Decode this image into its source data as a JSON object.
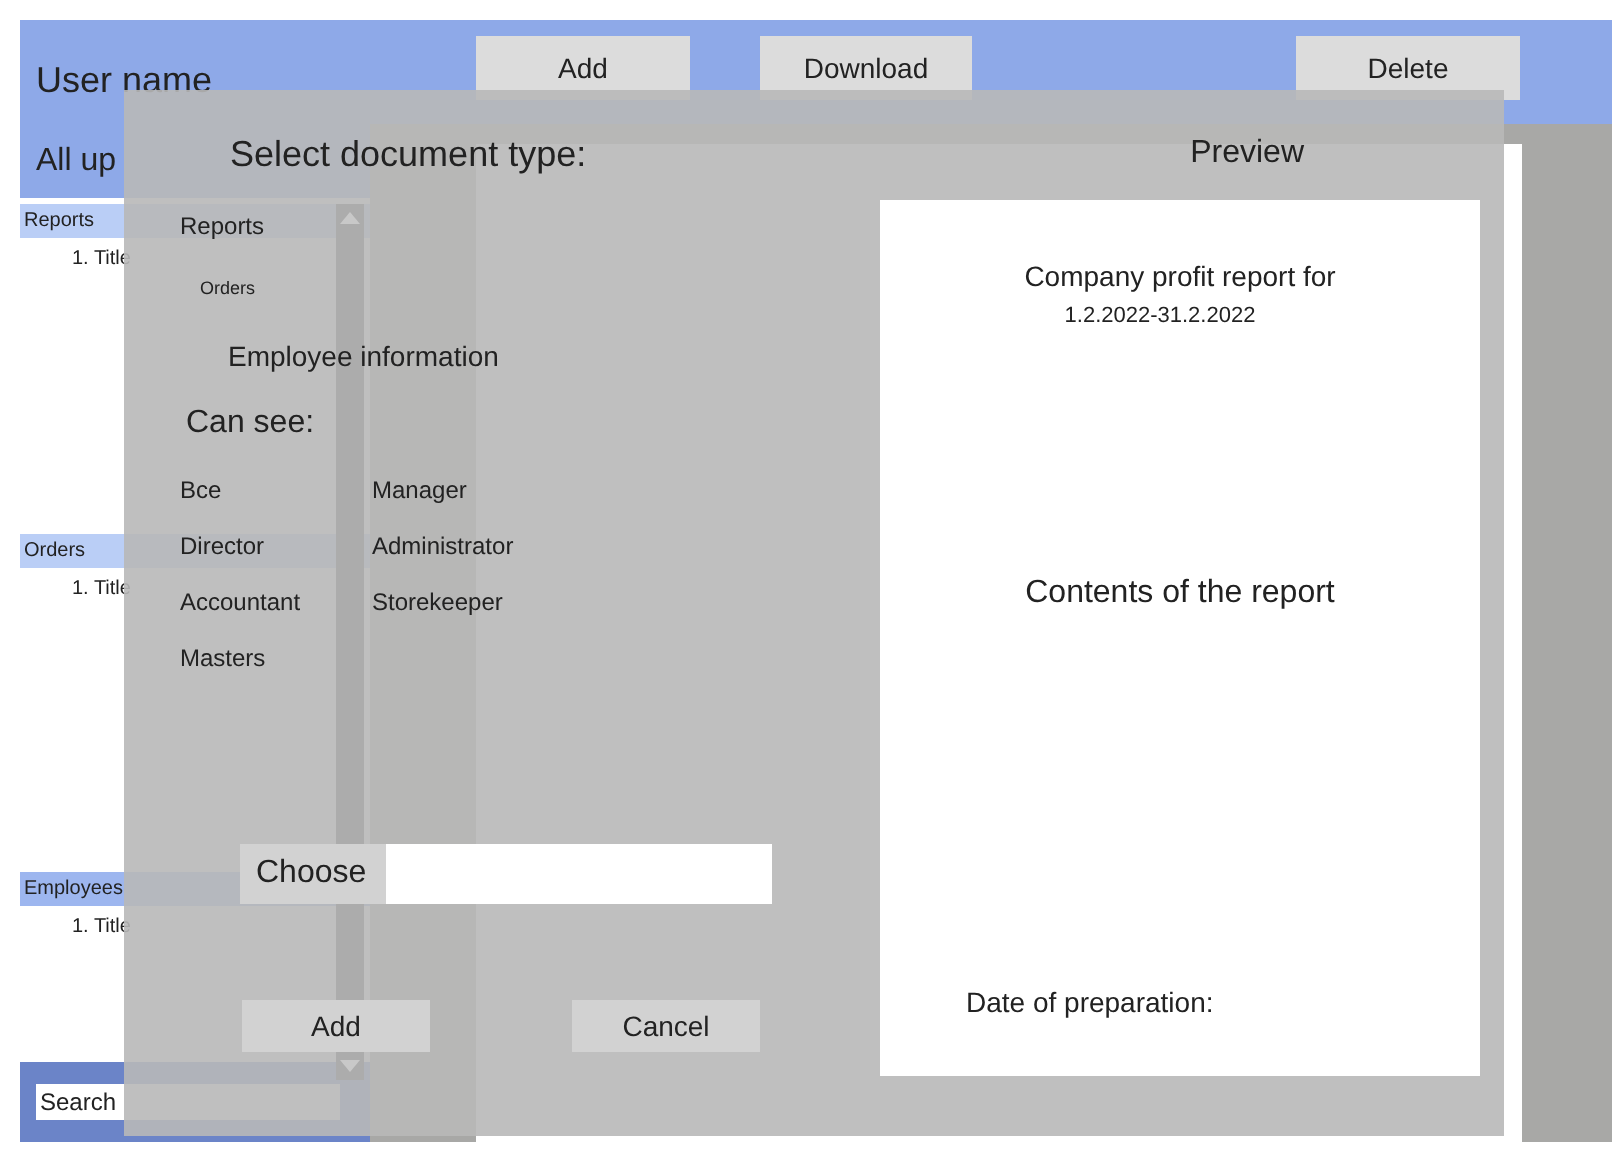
{
  "header": {
    "user_name": "User name",
    "buttons": [
      "Add",
      "Download",
      "Delete"
    ]
  },
  "sidebar": {
    "filter": "All up",
    "sections": [
      {
        "title": "Reports",
        "items": [
          "1. Title"
        ]
      },
      {
        "title": "Orders",
        "items": [
          "1. Title"
        ]
      },
      {
        "title": "Employees",
        "items": [
          "1. Title"
        ]
      }
    ],
    "search": {
      "placeholder": "Search"
    }
  },
  "dialog": {
    "title": "Select document type:",
    "document_types": [
      "Reports",
      "Orders",
      "Employee information"
    ],
    "can_see_label": "Can see:",
    "roles": [
      "Все",
      "Manager",
      "Director",
      "Administrator",
      "Accountant",
      "Storekeeper",
      "Masters"
    ],
    "choose_button": "Choose",
    "buttons": [
      "Add",
      "Cancel"
    ],
    "preview": {
      "label": "Preview",
      "report_title": "Company profit report for",
      "period": "1.2.2022-31.2.2022",
      "contents": "Contents of the report",
      "date_label": "Date of preparation:"
    }
  }
}
